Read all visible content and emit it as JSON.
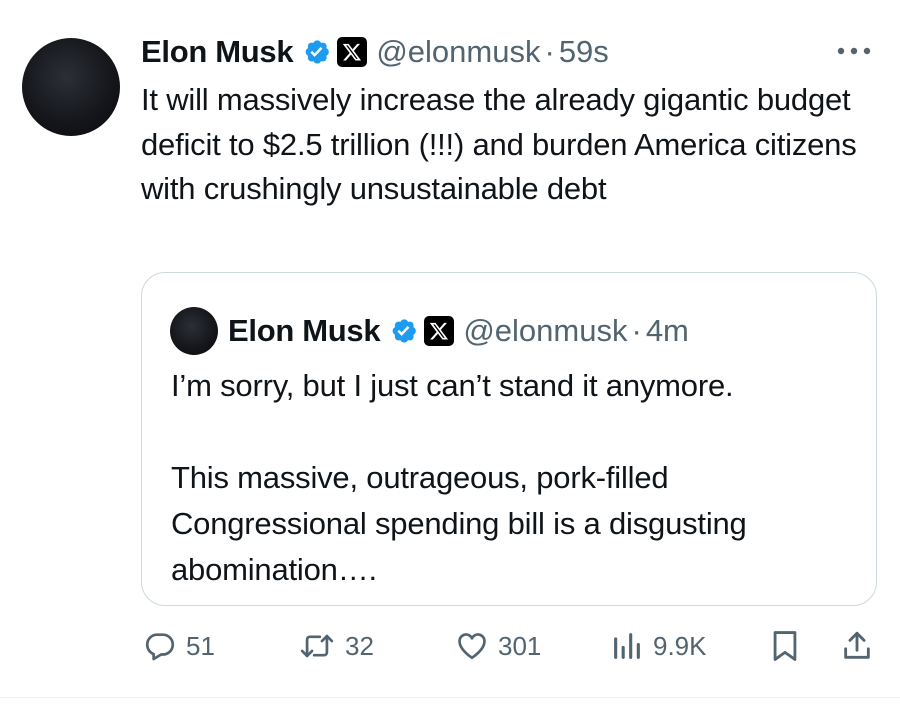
{
  "tweet": {
    "author_name": "Elon Musk",
    "handle": "@elonmusk",
    "separator": "·",
    "time": "59s",
    "text": "It will massively increase the already gigantic budget deficit to $2.5 trillion (!!!) and burden America citizens with crushingly unsustainable debt"
  },
  "quote": {
    "author_name": "Elon Musk",
    "handle": "@elonmusk",
    "separator": "·",
    "time": "4m",
    "text": "I’m sorry, but I just can’t stand it anymore.\n\nThis massive, outrageous, pork-filled Congressional spending bill is a disgusting abomination…."
  },
  "actions": {
    "replies": "51",
    "reposts": "32",
    "likes": "301",
    "views": "9.9K"
  },
  "icons": {
    "verified": "verified-badge-icon",
    "affiliate": "x-logo-icon",
    "more": "more-icon",
    "reply": "reply-icon",
    "repost": "repost-icon",
    "like": "heart-icon",
    "views": "views-icon",
    "bookmark": "bookmark-icon",
    "share": "share-icon"
  },
  "colors": {
    "text": "#0f1419",
    "secondary": "#536471",
    "verified": "#1d9bf0",
    "border": "#cfd9de"
  }
}
